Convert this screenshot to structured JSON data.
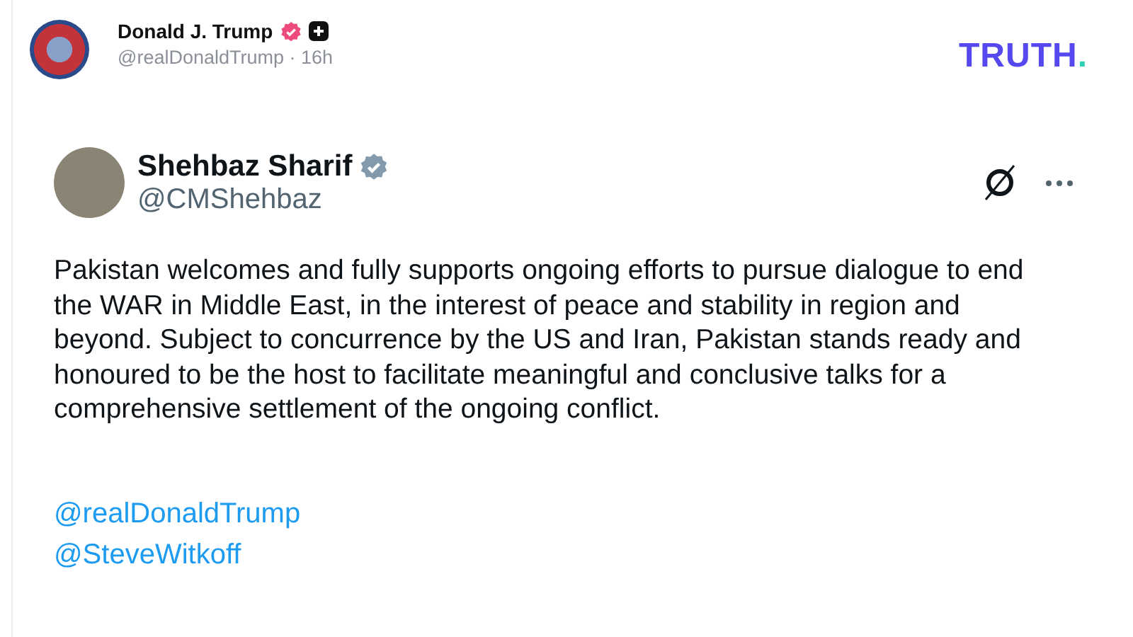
{
  "post": {
    "author": "Donald J. Trump",
    "handle": "@realDonaldTrump",
    "separator": "·",
    "time": "16h",
    "verified": true
  },
  "logo": {
    "text": "TRUTH",
    "dot": "."
  },
  "embedded_post": {
    "author": "Shehbaz Sharif",
    "handle": "@CMShehbaz",
    "verified": true,
    "text": "Pakistan welcomes and fully supports ongoing efforts to pursue dialogue to end the WAR in Middle East, in the interest of peace and stability in region and beyond. Subject to concurrence by the US and Iran, Pakistan stands ready and honoured to be the host to facilitate meaningful and conclusive talks for a comprehensive settlement of the ongoing conflict.",
    "mentions": [
      "@realDonaldTrump",
      "@SteveWitkoff"
    ]
  }
}
